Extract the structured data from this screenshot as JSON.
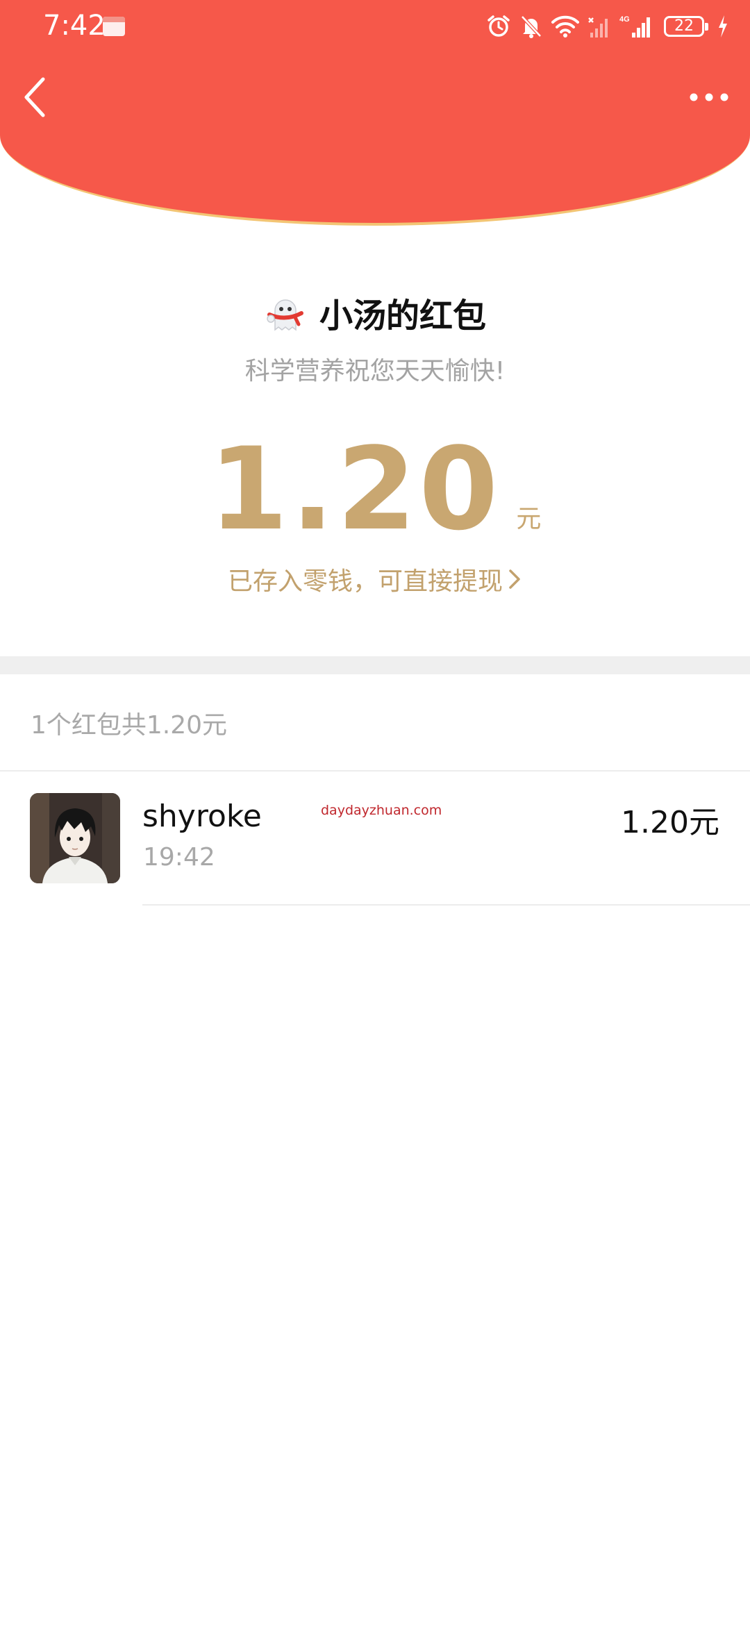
{
  "status_bar": {
    "time": "7:42",
    "network": "4G",
    "battery": "22"
  },
  "header": {
    "background_color": "#f6584a",
    "edge_color": "#f3c574",
    "back_icon": "chevron-left-icon",
    "more_icon": "more-dots-icon"
  },
  "packet": {
    "icon": "ghost-mascot-icon",
    "title": "小汤的红包",
    "greeting": "科学营养祝您天天愉快!",
    "amount": "1.20",
    "unit": "元",
    "stored_text": "已存入零钱，可直接提现",
    "accent_color": "#c9a771"
  },
  "summary": {
    "text": "1个红包共1.20元"
  },
  "records": [
    {
      "name": "shyroke",
      "time": "19:42",
      "amount": "1.20元",
      "watermark": "daydayzhuan.com"
    }
  ]
}
